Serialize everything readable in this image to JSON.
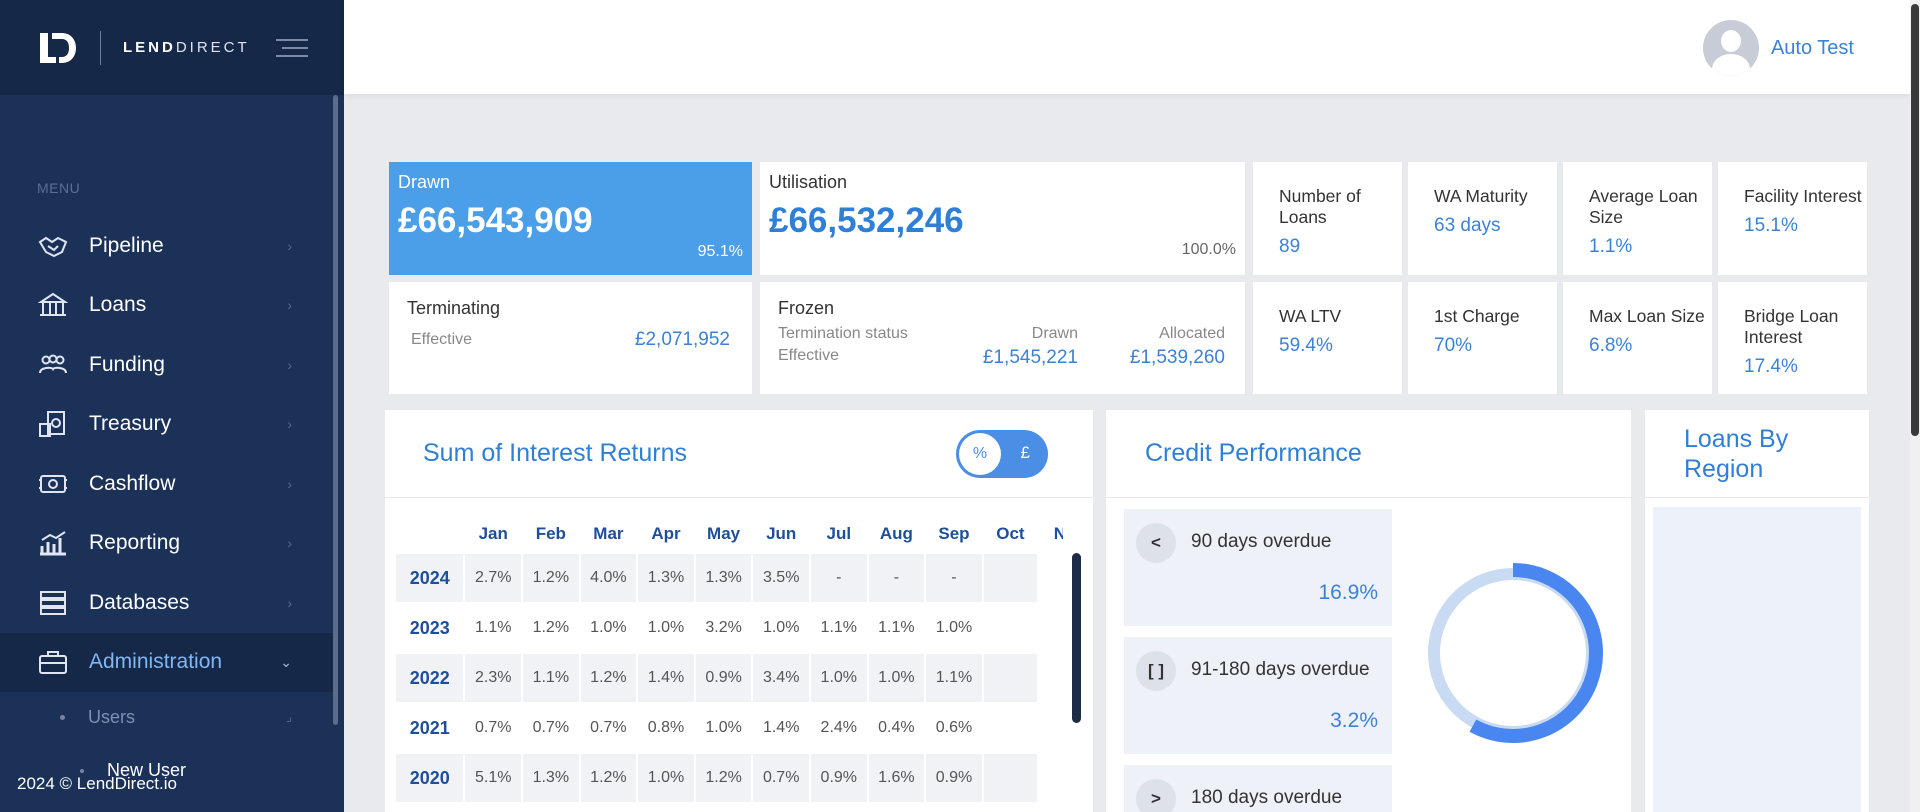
{
  "brand": {
    "name_bold": "LEND",
    "name_rest": "DIRECT",
    "logo": "LD"
  },
  "sidebar": {
    "menu_label": "MENU",
    "items": [
      {
        "label": "Pipeline",
        "icon": "handshake-icon"
      },
      {
        "label": "Loans",
        "icon": "bank-icon"
      },
      {
        "label": "Funding",
        "icon": "people-icon"
      },
      {
        "label": "Treasury",
        "icon": "money-icon"
      },
      {
        "label": "Cashflow",
        "icon": "cash-icon"
      },
      {
        "label": "Reporting",
        "icon": "chart-icon"
      },
      {
        "label": "Databases",
        "icon": "server-icon"
      },
      {
        "label": "Administration",
        "icon": "briefcase-icon",
        "active": true
      }
    ],
    "sub_items": [
      {
        "label": "Users"
      },
      {
        "label": "New User"
      }
    ],
    "footer": "2024 © LendDirect.io"
  },
  "topbar": {
    "user_name": "Auto Test"
  },
  "kpis": {
    "drawn": {
      "title": "Drawn",
      "value": "£66,543,909",
      "pct": "95.1%"
    },
    "utilisation": {
      "title": "Utilisation",
      "value": "£66,532,246",
      "pct": "100.0%"
    },
    "stats": [
      {
        "title": "Number of Loans",
        "value": "89"
      },
      {
        "title": "WA Maturity",
        "value": "63 days"
      },
      {
        "title": "Average Loan Size",
        "value": "1.1%"
      },
      {
        "title": "Facility Interest",
        "value": "15.1%"
      },
      {
        "title": "WA LTV",
        "value": "59.4%"
      },
      {
        "title": "1st Charge",
        "value": "70%"
      },
      {
        "title": "Max Loan Size",
        "value": "6.8%"
      },
      {
        "title": "Bridge Loan Interest",
        "value": "17.4%"
      }
    ],
    "terminating": {
      "title": "Terminating",
      "label": "Effective",
      "value": "£2,071,952"
    },
    "frozen": {
      "title": "Frozen",
      "status_label": "Termination status",
      "drawn_label": "Drawn",
      "allocated_label": "Allocated",
      "effective_label": "Effective",
      "drawn_value": "£1,545,221",
      "allocated_value": "£1,539,260"
    }
  },
  "interest": {
    "title": "Sum of Interest Returns",
    "toggle": {
      "left": "%",
      "right": "£"
    },
    "months": [
      "Jan",
      "Feb",
      "Mar",
      "Apr",
      "May",
      "Jun",
      "Jul",
      "Aug",
      "Sep",
      "Oct",
      "No"
    ],
    "rows": [
      {
        "year": "2024",
        "values": [
          "2.7%",
          "1.2%",
          "4.0%",
          "1.3%",
          "1.3%",
          "3.5%",
          "-",
          "-",
          "-",
          ""
        ]
      },
      {
        "year": "2023",
        "values": [
          "1.1%",
          "1.2%",
          "1.0%",
          "1.0%",
          "3.2%",
          "1.0%",
          "1.1%",
          "1.1%",
          "1.0%",
          ""
        ]
      },
      {
        "year": "2022",
        "values": [
          "2.3%",
          "1.1%",
          "1.2%",
          "1.4%",
          "0.9%",
          "3.4%",
          "1.0%",
          "1.0%",
          "1.1%",
          ""
        ]
      },
      {
        "year": "2021",
        "values": [
          "0.7%",
          "0.7%",
          "0.7%",
          "0.8%",
          "1.0%",
          "1.4%",
          "2.4%",
          "0.4%",
          "0.6%",
          ""
        ]
      },
      {
        "year": "2020",
        "values": [
          "5.1%",
          "1.3%",
          "1.2%",
          "1.0%",
          "1.2%",
          "0.7%",
          "0.9%",
          "1.6%",
          "0.9%",
          ""
        ]
      }
    ]
  },
  "credit": {
    "title": "Credit Performance",
    "items": [
      {
        "icon": "<",
        "label": "90 days overdue",
        "value": "16.9%"
      },
      {
        "icon": "[ ]",
        "label": "91-180 days overdue",
        "value": "3.2%"
      },
      {
        "icon": ">",
        "label": "180 days overdue",
        "value": ""
      }
    ],
    "donut_fraction": 0.58,
    "colors": {
      "arc": "#4a86f0",
      "track": "#c9daf3"
    }
  },
  "region": {
    "title": "Loans By Region"
  }
}
